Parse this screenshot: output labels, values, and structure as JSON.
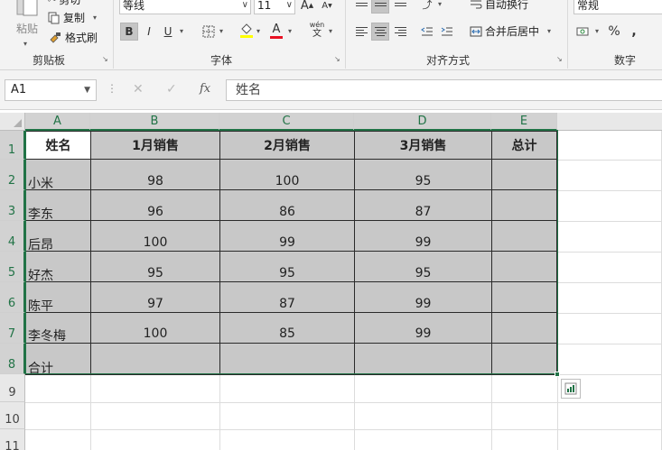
{
  "ribbon": {
    "clipboard": {
      "paste_label": "粘贴",
      "cut_label": "剪切",
      "copy_label": "复制",
      "format_painter_label": "格式刷",
      "group_title": "剪贴板"
    },
    "font": {
      "font_name": "等线",
      "font_size": "11",
      "bold": "B",
      "italic": "I",
      "underline": "U",
      "font_color_glyph": "A",
      "phonetic_top": "wén",
      "phonetic_bottom": "文",
      "grow_font": "A",
      "shrink_font": "A",
      "group_title": "字体"
    },
    "alignment": {
      "wrap_text_label": "自动换行",
      "merge_center_label": "合并后居中",
      "group_title": "对齐方式"
    },
    "number": {
      "format_value": "常规",
      "percent": "%",
      "comma": ",",
      "group_title": "数字"
    }
  },
  "formula_bar": {
    "name_box": "A1",
    "cancel_glyph": "✕",
    "enter_glyph": "✓",
    "fx_glyph": "fx",
    "content": "姓名"
  },
  "columns": [
    "A",
    "B",
    "C",
    "D",
    "E"
  ],
  "rows": [
    "1",
    "2",
    "3",
    "4",
    "5",
    "6",
    "7",
    "8",
    "9",
    "10",
    "11"
  ],
  "table": {
    "headers": [
      "姓名",
      "1月销售",
      "2月销售",
      "3月销售",
      "总计"
    ],
    "rows": [
      [
        "小米",
        "98",
        "100",
        "95",
        ""
      ],
      [
        "李东",
        "96",
        "86",
        "87",
        ""
      ],
      [
        "后昂",
        "100",
        "99",
        "99",
        ""
      ],
      [
        "好杰",
        "95",
        "95",
        "95",
        ""
      ],
      [
        "陈平",
        "97",
        "87",
        "99",
        ""
      ],
      [
        "李冬梅",
        "100",
        "85",
        "99",
        ""
      ],
      [
        "合计",
        "",
        "",
        "",
        ""
      ]
    ]
  },
  "colors": {
    "accent": "#217346",
    "selection_fill": "#c8c8c8",
    "font_color_bar": "#e81123",
    "highlight_bar": "#ffff00"
  }
}
